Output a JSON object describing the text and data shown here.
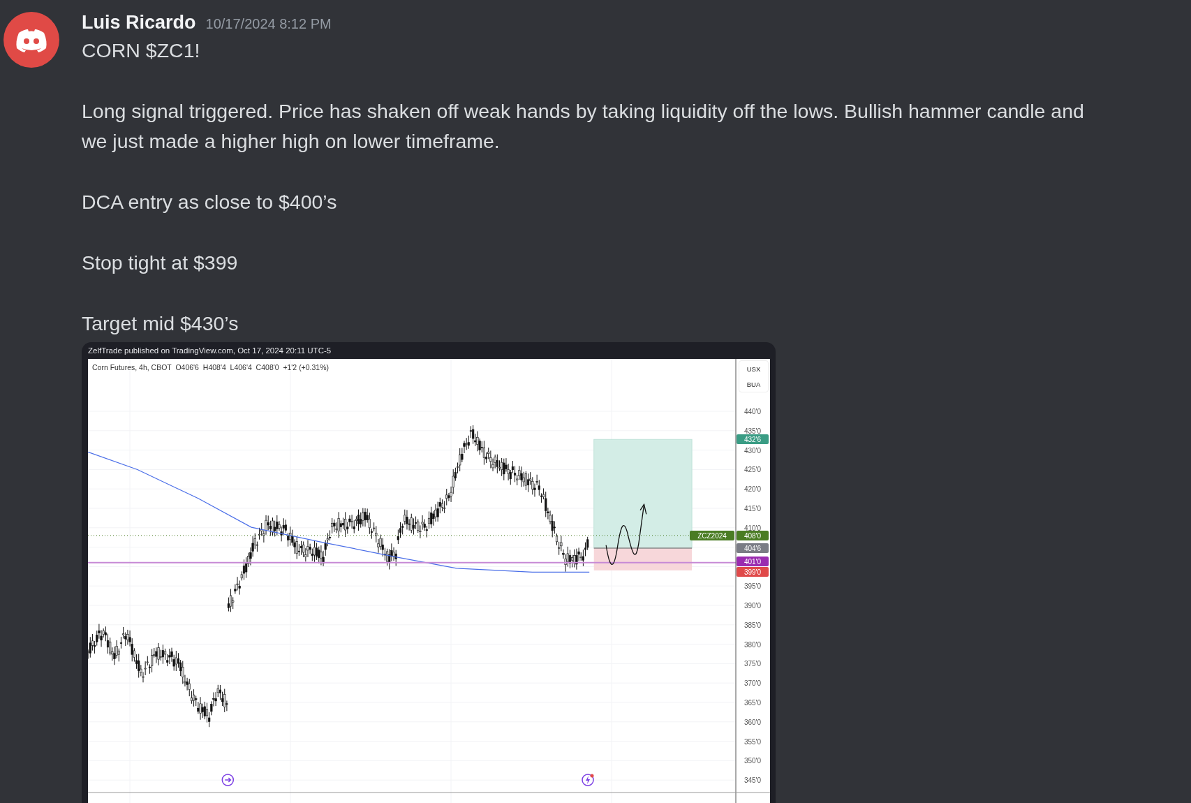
{
  "author": {
    "name": "Luis Ricardo",
    "timestamp": "10/17/2024 8:12 PM"
  },
  "message": {
    "paragraphs": [
      "CORN $ZC1!",
      "Long signal triggered. Price has shaken off weak hands by taking liquidity off the lows. Bullish hammer candle and we just made a higher high on lower timeframe.",
      "DCA entry as close to $400’s",
      "Stop tight at $399",
      "Target mid $430’s"
    ]
  },
  "attachment": {
    "caption": "ZelfTrade published on TradingView.com, Oct 17, 2024 20:11 UTC-5",
    "legend": "Corn Futures, 4h, CBOT  O406'6  H408'4  L406'4  C408'0  +1'2 (+0.31%)",
    "currency": [
      "USX",
      "BUA"
    ],
    "axis_ticks": [
      "440'0",
      "435'0",
      "430'0",
      "425'0",
      "420'0",
      "415'0",
      "410'0",
      "395'0",
      "390'0",
      "385'0",
      "380'0",
      "375'0",
      "370'0",
      "365'0",
      "360'0",
      "355'0",
      "350'0",
      "345'0"
    ],
    "price_tags": [
      {
        "label": "432'6",
        "color": "#3a9c84"
      },
      {
        "label": "408'0",
        "symbol": "ZCZ2024",
        "color": "#4a7c23"
      },
      {
        "label": "404'6",
        "color": "#7a7c85"
      },
      {
        "label": "401'0",
        "color": "#9a2cb0"
      },
      {
        "label": "399'0",
        "color": "#e04a4a"
      }
    ]
  }
}
